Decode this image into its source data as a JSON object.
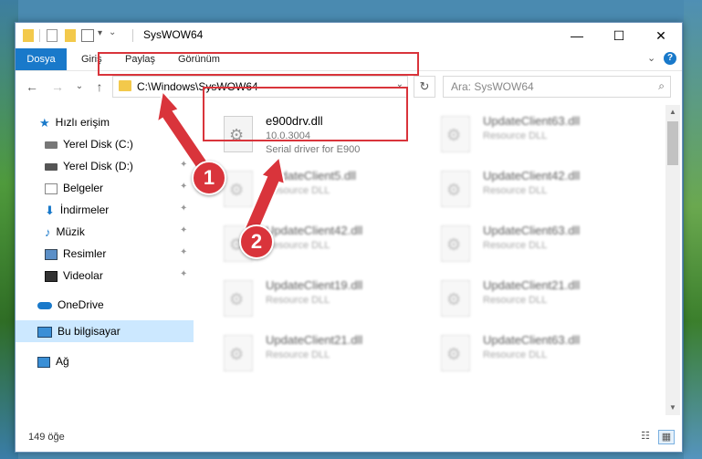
{
  "window": {
    "title": "SysWOW64",
    "minimize_glyph": "—",
    "maximize_glyph": "☐",
    "close_glyph": "✕"
  },
  "ribbon": {
    "tabs": [
      "Dosya",
      "Giriş",
      "Paylaş",
      "Görünüm"
    ],
    "expand_glyph": "⌄",
    "help_glyph": "?"
  },
  "navbar": {
    "back_glyph": "←",
    "forward_glyph": "→",
    "recent_glyph": "⌄",
    "up_glyph": "↑",
    "address": "C:\\Windows\\SysWOW64",
    "dropdown_glyph": "⌄",
    "refresh_glyph": "↻",
    "search_placeholder": "Ara: SysWOW64",
    "search_glyph": "⌕"
  },
  "sidebar": {
    "quick_access": "Hızlı erişim",
    "items": [
      "Yerel Disk (C:)",
      "Yerel Disk (D:)",
      "Belgeler",
      "İndirmeler",
      "Müzik",
      "Resimler",
      "Videolar"
    ],
    "pin_glyph": "✦",
    "onedrive": "OneDrive",
    "this_pc": "Bu bilgisayar",
    "network": "Ağ"
  },
  "files": {
    "main": {
      "name": "e900drv.dll",
      "version": "10.0.3004",
      "description": "Serial driver for E900"
    },
    "left_column": [
      {
        "name": "UpdateClient5.dll",
        "type": "Resource DLL"
      },
      {
        "name": "UpdateClient42.dll",
        "type": "Resource DLL"
      },
      {
        "name": "UpdateClient19.dll",
        "type": "Resource DLL"
      },
      {
        "name": "UpdateClient21.dll",
        "type": "Resource DLL"
      }
    ],
    "right_column": [
      {
        "name": "UpdateClient63.dll",
        "type": "Resource DLL"
      },
      {
        "name": "UpdateClient42.dll",
        "type": "Resource DLL"
      },
      {
        "name": "UpdateClient63.dll",
        "type": "Resource DLL"
      },
      {
        "name": "UpdateClient21.dll",
        "type": "Resource DLL"
      },
      {
        "name": "UpdateClient63.dll",
        "type": "Resource DLL"
      }
    ]
  },
  "status": {
    "item_count": "149 öğe"
  },
  "callouts": [
    "1",
    "2"
  ],
  "colors": {
    "accent": "#1979ca",
    "highlight": "#d9343b",
    "selected": "#cce8ff",
    "folder": "#f3c94b"
  }
}
